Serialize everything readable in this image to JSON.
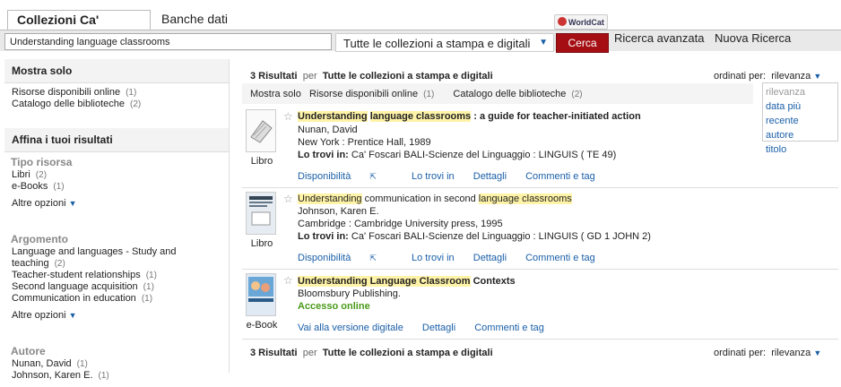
{
  "tabs": {
    "active": "Collezioni Ca' Foscari",
    "other": "Banche dati",
    "worldcat": "WorldCat"
  },
  "search": {
    "query": "Understanding language classrooms",
    "scope": "Tutte le collezioni a stampa e digitali",
    "button": "Cerca",
    "advanced": "Ricerca avanzata",
    "new": "Nuova Ricerca"
  },
  "sidebar": {
    "show_only_title": "Mostra solo",
    "show_only": [
      {
        "label": "Risorse disponibili online",
        "count": "(1)"
      },
      {
        "label": "Catalogo delle biblioteche",
        "count": "(2)"
      }
    ],
    "refine_title": "Affina i tuoi risultati",
    "facets": [
      {
        "title": "Tipo risorsa",
        "items": [
          {
            "label": "Libri",
            "count": "(2)"
          },
          {
            "label": "e-Books",
            "count": "(1)"
          }
        ],
        "more": "Altre opzioni"
      },
      {
        "title": "Argomento",
        "items": [
          {
            "label": "Language and languages - Study and teaching",
            "count": "(2)"
          },
          {
            "label": "Teacher-student relationships",
            "count": "(1)"
          },
          {
            "label": "Second language acquisition",
            "count": "(1)"
          },
          {
            "label": "Communication in education",
            "count": "(1)"
          }
        ],
        "more": "Altre opzioni"
      },
      {
        "title": "Autore",
        "items": [
          {
            "label": "Nunan, David",
            "count": "(1)"
          },
          {
            "label": "Johnson, Karen E.",
            "count": "(1)"
          }
        ]
      }
    ]
  },
  "results": {
    "count_text": "3 Risultati",
    "per": "per",
    "scope": "Tutte le collezioni a stampa e digitali",
    "sort_label": "ordinati per:",
    "sort_value": "rilevanza",
    "sort_options": [
      "rilevanza",
      "data più recente",
      "autore",
      "titolo"
    ],
    "filter_label": "Mostra solo",
    "filters": [
      {
        "label": "Risorse disponibili online",
        "count": "(1)"
      },
      {
        "label": "Catalogo delle biblioteche",
        "count": "(2)"
      }
    ]
  },
  "records": [
    {
      "format": "Libro",
      "title_parts": [
        "Understanding",
        " ",
        "language classrooms",
        " : a guide for teacher-initiated action"
      ],
      "author": "Nunan, David",
      "publication": "New York : Prentice Hall, 1989",
      "location_label": "Lo trovi in:",
      "location": "Ca' Foscari BALI-Scienze del Linguaggio : LINGUIS ( TE 49)",
      "links": [
        "Disponibilità",
        "Lo trovi in",
        "Dettagli",
        "Commenti e tag"
      ]
    },
    {
      "format": "Libro",
      "title_parts": [
        "Understanding",
        " communication in second ",
        "language classrooms",
        ""
      ],
      "author": "Johnson, Karen E.",
      "publication": "Cambridge : Cambridge University press, 1995",
      "location_label": "Lo trovi in:",
      "location": "Ca' Foscari BALI-Scienze del Linguaggio : LINGUIS ( GD 1 JOHN 2)",
      "links": [
        "Disponibilità",
        "Lo trovi in",
        "Dettagli",
        "Commenti e tag"
      ]
    },
    {
      "format": "e-Book",
      "title_parts": [
        "Understanding Language Classroom",
        " Contexts"
      ],
      "publisher": "Bloomsbury Publishing.",
      "online": "Accesso online",
      "links": [
        "Vai alla versione digitale",
        "Dettagli",
        "Commenti e tag"
      ]
    }
  ],
  "colors": {
    "accent": "#a50f14",
    "link": "#1a5fa8",
    "highlight": "#fff3a8",
    "online": "#4a9a1a"
  }
}
